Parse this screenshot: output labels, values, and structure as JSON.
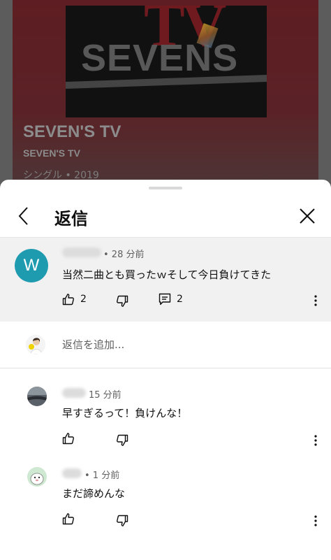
{
  "background": {
    "cover_text_top": "TV",
    "cover_text_main": "SEVENS",
    "title": "SEVEN'S TV",
    "artist": "SEVEN'S TV",
    "meta": "シングル • 2019"
  },
  "sheet": {
    "title": "返信",
    "back_icon": "chevron-left-icon",
    "close_icon": "close-icon"
  },
  "parent_comment": {
    "avatar_letter": "W",
    "avatar_color": "#1f9bb0",
    "time": "• 28 分前",
    "text": "当然二曲とも買ったｗそして今日負けてきた",
    "likes": "2",
    "replies": "2"
  },
  "add_reply": {
    "placeholder": "返信を追加..."
  },
  "replies": [
    {
      "time": "15 分前",
      "text": "早すぎるって！負けんな！"
    },
    {
      "time": "• 1 分前",
      "text": "まだ諦めんな"
    }
  ]
}
